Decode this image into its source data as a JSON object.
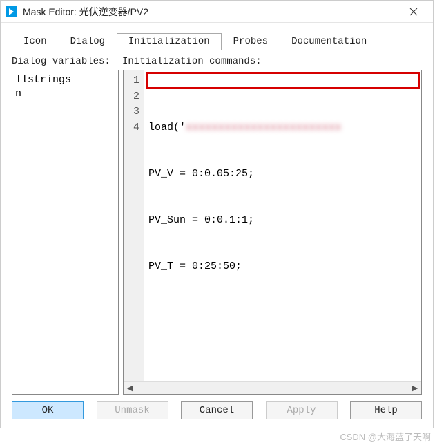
{
  "titlebar": {
    "app_name": "Mask Editor",
    "subject": "光伏逆变器/PV2"
  },
  "tabs": [
    {
      "label": "Icon"
    },
    {
      "label": "Dialog"
    },
    {
      "label": "Initialization"
    },
    {
      "label": "Probes"
    },
    {
      "label": "Documentation"
    }
  ],
  "labels": {
    "dialog_vars": "Dialog variables:",
    "init_cmds": "Initialization commands:"
  },
  "dialog_variables": [
    "llstrings",
    "n"
  ],
  "code_lines": [
    {
      "n": "1",
      "prefix": "load('",
      "blurred": "xxxxxxxxxxxxxxxxxxxxxxxx"
    },
    {
      "n": "2",
      "text": "PV_V = 0:0.05:25;"
    },
    {
      "n": "3",
      "text": "PV_Sun = 0:0.1:1;"
    },
    {
      "n": "4",
      "text": "PV_T = 0:25:50;"
    }
  ],
  "buttons": {
    "ok": "OK",
    "unmask": "Unmask",
    "cancel": "Cancel",
    "apply": "Apply",
    "help": "Help"
  },
  "watermark": "CSDN @大海蓝了天啊"
}
